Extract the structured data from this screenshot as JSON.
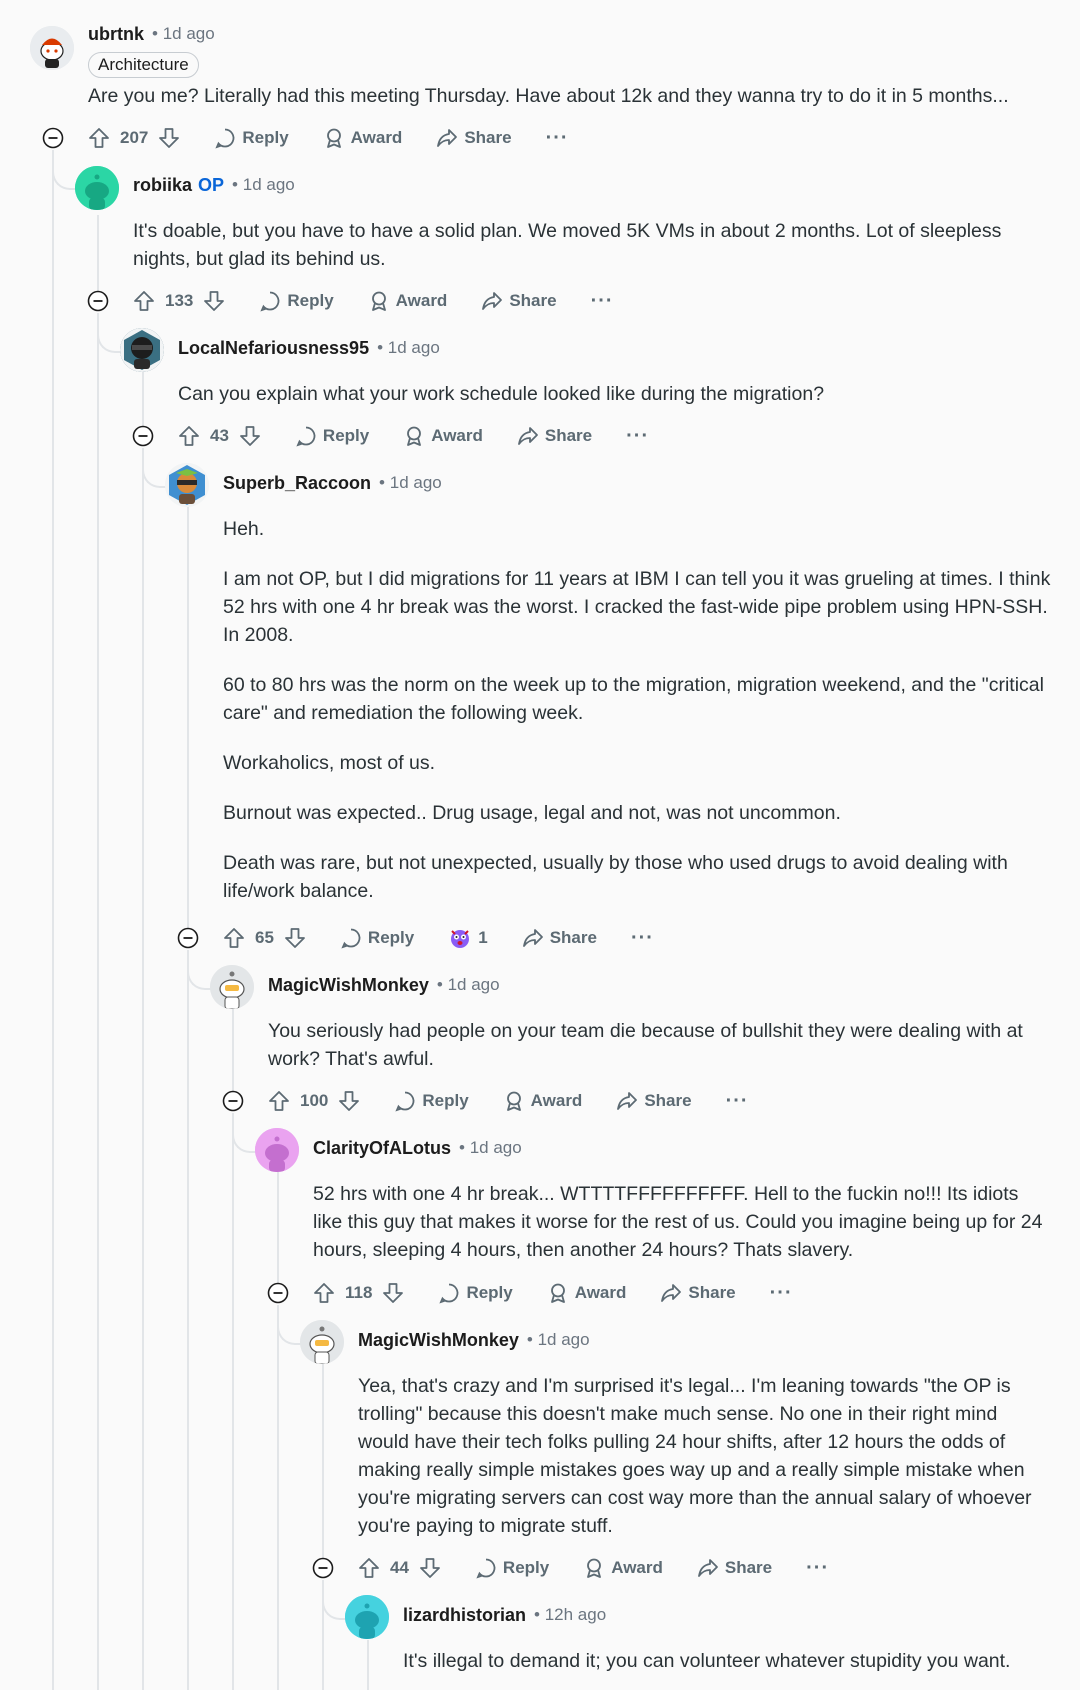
{
  "comments": [
    {
      "author": "ubrtnk",
      "op_badge": "",
      "time": "1d ago",
      "flair": "Architecture",
      "body": [
        "Are you me? Literally had this meeting Thursday. Have about 12k and they wanna try to do it in 5 months..."
      ],
      "score": "207",
      "reply": "Reply",
      "award": "Award",
      "share": "Share",
      "more": "···"
    },
    {
      "author": "robiika",
      "op_badge": "OP",
      "time": "1d ago",
      "body": [
        "It's doable, but you have to have a solid plan. We moved 5K VMs in about 2 months. Lot of sleepless nights, but glad its behind us."
      ],
      "score": "133",
      "reply": "Reply",
      "award": "Award",
      "share": "Share",
      "more": "···"
    },
    {
      "author": "LocalNefariousness95",
      "op_badge": "",
      "time": "1d ago",
      "body": [
        "Can you explain what your work schedule looked like during the migration?"
      ],
      "score": "43",
      "reply": "Reply",
      "award": "Award",
      "share": "Share",
      "more": "···"
    },
    {
      "author": "Superb_Raccoon",
      "op_badge": "",
      "time": "1d ago",
      "body": [
        "Heh.",
        "I am not OP, but I did migrations for 11 years at IBM I can tell you it was grueling at times. I think 52 hrs with one 4 hr break was the worst. I cracked the fast-wide pipe problem using HPN-SSH. In 2008.",
        "60 to 80 hrs was the norm on the week up to the migration, migration weekend, and the \"critical care\" and remediation the following week.",
        "Workaholics, most of us.",
        "Burnout was expected.. Drug usage, legal and not, was not uncommon.",
        "Death was rare, but not unexpected, usually by those who used drugs to avoid dealing with life/work balance."
      ],
      "score": "65",
      "reply": "Reply",
      "award_count": "1",
      "share": "Share",
      "more": "···"
    },
    {
      "author": "MagicWishMonkey",
      "op_badge": "",
      "time": "1d ago",
      "body": [
        "You seriously had people on your team die because of bullshit they were dealing with at work? That's awful."
      ],
      "score": "100",
      "reply": "Reply",
      "award": "Award",
      "share": "Share",
      "more": "···"
    },
    {
      "author": "ClarityOfALotus",
      "op_badge": "",
      "time": "1d ago",
      "body": [
        "52 hrs with one 4 hr break... WTTTTFFFFFFFFFF. Hell to the fuckin no!!! Its idiots like this guy that makes it worse for the rest of us. Could you imagine being up for 24 hours, sleeping 4 hours, then another 24 hours? Thats slavery."
      ],
      "score": "118",
      "reply": "Reply",
      "award": "Award",
      "share": "Share",
      "more": "···"
    },
    {
      "author": "MagicWishMonkey",
      "op_badge": "",
      "time": "1d ago",
      "body": [
        "Yea, that's crazy and I'm surprised it's legal... I'm leaning towards \"the OP is trolling\" because this doesn't make much sense. No one in their right mind would have their tech folks pulling 24 hour shifts, after 12 hours the odds of making really simple mistakes goes way up and a really simple mistake when you're migrating servers can cost way more than the annual salary of whoever you're paying to migrate stuff."
      ],
      "score": "44",
      "reply": "Reply",
      "award": "Award",
      "share": "Share",
      "more": "···"
    },
    {
      "author": "lizardhistorian",
      "op_badge": "",
      "time": "12h ago",
      "body": [
        "It's illegal to demand it; you can volunteer whatever stupidity you want."
      ]
    }
  ],
  "colors": {
    "thread_line": "#e2e5e8",
    "op_badge": "#0a66d8",
    "action_text": "#5c6a73"
  }
}
